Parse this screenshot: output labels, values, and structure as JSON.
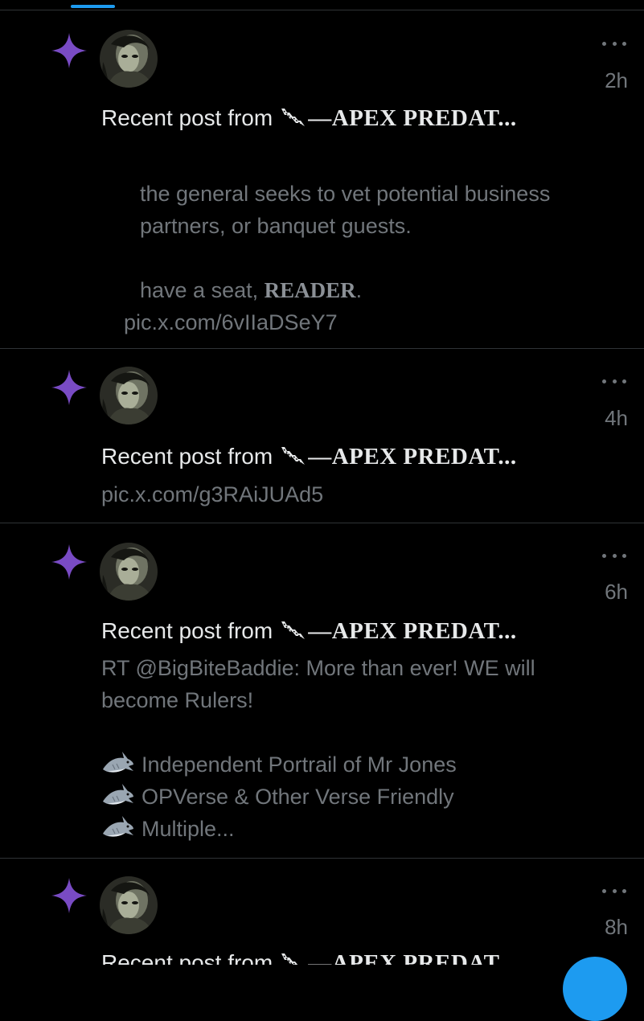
{
  "colors": {
    "background": "#000000",
    "accent": "#1d9bf0",
    "star": "#794bc4",
    "text_primary": "#e7e9ea",
    "text_secondary": "#71767b",
    "divider": "#2f3336"
  },
  "icons": {
    "star": "sparkle-star-icon",
    "more": "more-horizontal-icon",
    "decoration": "lightning-bolt-icon",
    "shark": "shark-emoji-icon"
  },
  "notifications": [
    {
      "time": "2h",
      "prefix": "Recent post from",
      "name": "—APEX PREDAT...",
      "paragraph1": "the general seeks to vet potential business partners, or banquet guests.",
      "paragraph2_before": "have a seat, ",
      "paragraph2_bold": "READER",
      "paragraph2_after": ".",
      "link": "pic.x.com/6vIIaDSeY7"
    },
    {
      "time": "4h",
      "prefix": "Recent post from",
      "name": "—APEX PREDAT...",
      "link": "pic.x.com/g3RAiJUAd5"
    },
    {
      "time": "6h",
      "prefix": "Recent post from",
      "name": "—APEX PREDAT...",
      "line1": "RT @BigBiteBaddie: More than ever! WE will become Rulers!",
      "bullets": [
        "Independent Portrail of Mr Jones",
        "OPVerse & Other Verse Friendly",
        "Multiple..."
      ]
    },
    {
      "time": "8h",
      "prefix": "Recent post from",
      "name": "—APEX PREDAT..."
    }
  ]
}
